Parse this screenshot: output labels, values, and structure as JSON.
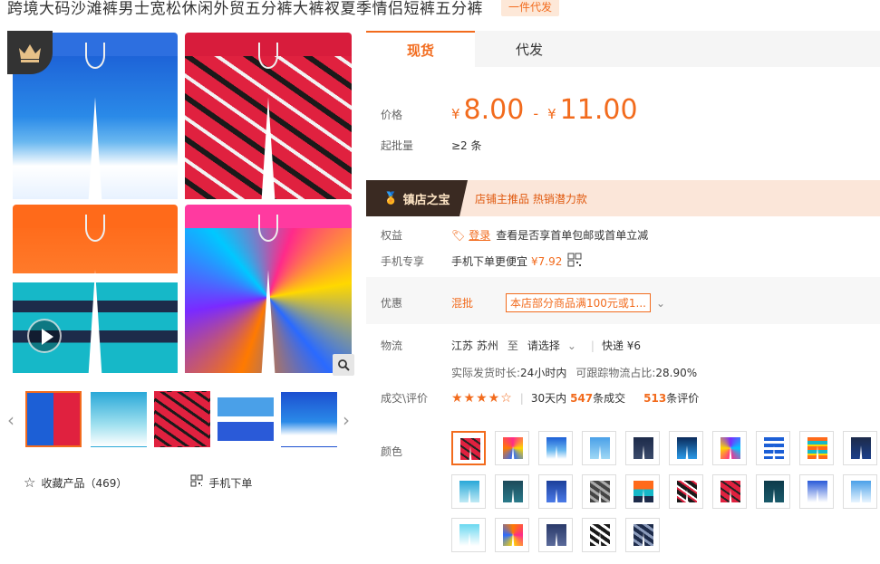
{
  "title": "跨境大码沙滩裤男士宽松休闲外贸五分裤大裤衩夏季情侣短裤五分裤",
  "title_tag": "一件代发",
  "tabs": [
    {
      "label": "现货",
      "active": true
    },
    {
      "label": "代发",
      "active": false
    }
  ],
  "price": {
    "label": "价格",
    "currency": "¥",
    "min": "8.00",
    "sep": "-",
    "max": "11.00"
  },
  "moq": {
    "label": "起批量",
    "value": "≥2 条"
  },
  "treasure": {
    "badge": "镇店之宝",
    "text": "店铺主推品  热销潜力款"
  },
  "benefits": {
    "label": "权益",
    "login": "登录",
    "text": "查看是否享首单包邮或首单立减"
  },
  "mobile": {
    "label": "手机专享",
    "text": "手机下单更便宜",
    "price": "¥7.92"
  },
  "promo": {
    "label": "优惠",
    "type": "混批",
    "coupon": "本店部分商品满100元或1..."
  },
  "logistics": {
    "label": "物流",
    "from": "江苏 苏州",
    "to_label": "至",
    "to_select": "请选择",
    "express": "快递 ¥6"
  },
  "shipping": {
    "time_label": "实际发货时长:",
    "time": "24小时内",
    "track_label": "可跟踪物流占比:",
    "track": "28.90%"
  },
  "reviews": {
    "label": "成交\\评价",
    "stars": "★★★★☆",
    "deals_prefix": "30天内",
    "deals": "547",
    "deals_suffix": "条成交",
    "reviews": "513",
    "reviews_suffix": "条评价"
  },
  "color_label": "颜色",
  "left_actions": {
    "favorite": "收藏产品（469）",
    "mobile_order": "手机下单"
  },
  "colors": {
    "accent": "#f26b1d",
    "tab_bg": "#f5f5f5",
    "treasure_bg": "#fbe6d9"
  },
  "icons": {
    "crown": "crown-icon",
    "play": "play-icon",
    "zoom": "magnifier-icon",
    "star": "star-outline-icon",
    "qr": "qr-code-icon"
  }
}
